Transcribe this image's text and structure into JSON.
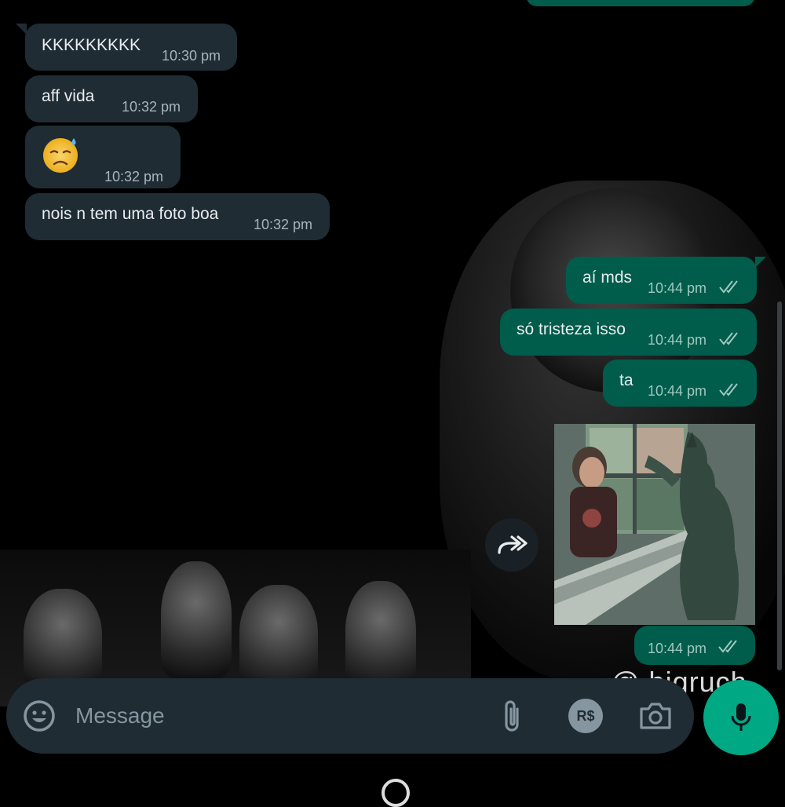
{
  "chat": {
    "messages": [
      {
        "direction": "incoming",
        "text": "KKKKKKKKK",
        "time": "10:30 pm"
      },
      {
        "direction": "incoming",
        "text": "aff vida",
        "time": "10:32 pm"
      },
      {
        "direction": "incoming",
        "emoji": "sad-sweat-face",
        "time": "10:32 pm"
      },
      {
        "direction": "incoming",
        "text": "nois n tem uma foto boa",
        "time": "10:32 pm"
      },
      {
        "direction": "outgoing",
        "text": "aí mds",
        "time": "10:44 pm",
        "status": "read"
      },
      {
        "direction": "outgoing",
        "text": "só tristeza isso",
        "time": "10:44 pm",
        "status": "read"
      },
      {
        "direction": "outgoing",
        "text": "ta",
        "time": "10:44 pm",
        "status": "read"
      },
      {
        "direction": "outgoing",
        "image": "werewolf-window-illustration",
        "time": "10:44 pm",
        "status": "read"
      }
    ],
    "wallpaper_text": "@ bigruch"
  },
  "composer": {
    "placeholder": "Message",
    "icons": [
      "emoji-icon",
      "attach-icon",
      "payment-icon",
      "camera-icon",
      "mic-icon"
    ],
    "payment_label": "R$"
  },
  "colors": {
    "incoming_bubble": "#1f2c34",
    "outgoing_bubble": "#005c4b",
    "accent": "#00a884",
    "read_ticks": "#9fc9c0"
  }
}
